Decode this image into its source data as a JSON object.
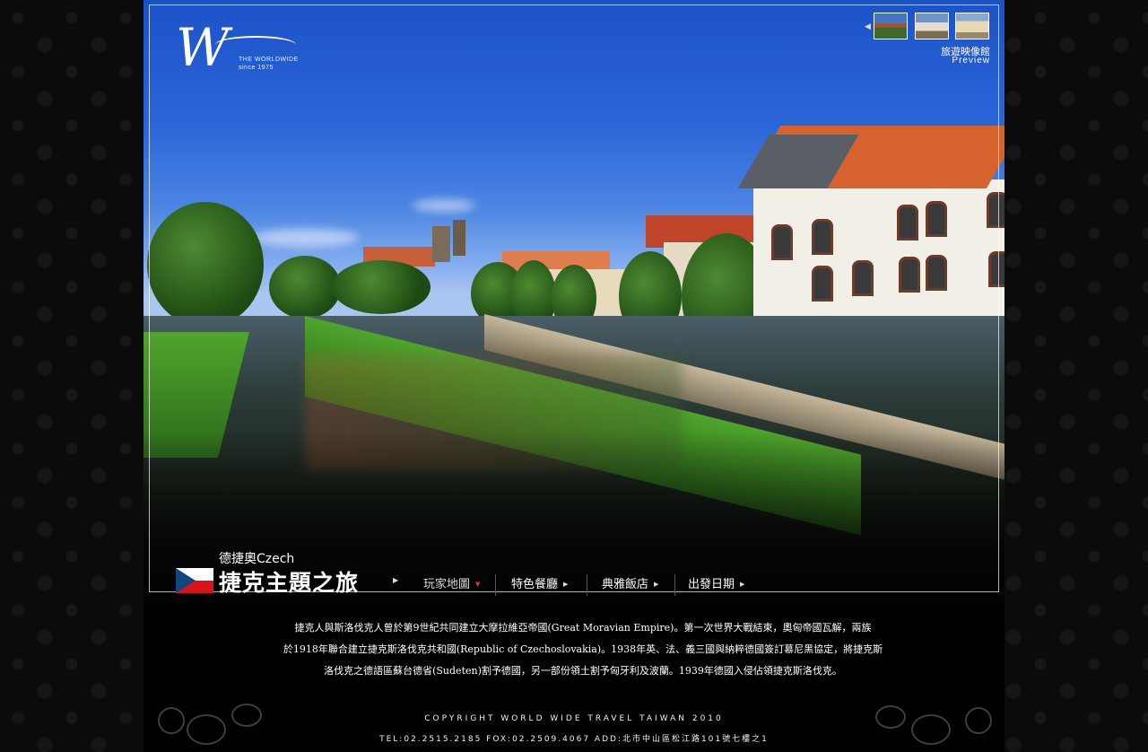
{
  "logo": {
    "mark": "W",
    "text_line1": "THE WORLDWIDE",
    "text_line2": "since 1975"
  },
  "gallery": {
    "title": "旅遊映像館",
    "subtitle": "Preview",
    "prev_icon": "arrow-left-icon"
  },
  "tour": {
    "subtitle": "德捷奧Czech",
    "title": "捷克主題之旅",
    "flag": "czech-flag"
  },
  "nav": [
    {
      "label": "玩家地圖",
      "active": true
    },
    {
      "label": "特色餐廳",
      "active": false
    },
    {
      "label": "典雅飯店",
      "active": false
    },
    {
      "label": "出發日期",
      "active": false
    }
  ],
  "intro": [
    "捷克人與斯洛伐克人曾於第9世紀共同建立大摩拉維亞帝國(Great Moravian Empire)。第一次世界大戰結束，奧匈帝國瓦解，兩族",
    "於1918年聯合建立捷克斯洛伐克共和國(Republic of Czechoslovakia)。1938年英、法、義三國與納粹德國簽訂慕尼黑協定，將捷克斯",
    "洛伐克之德語區蘇台德省(Sudeten)割予德國，另一部份領土割予匈牙利及波蘭。1939年德國入侵佔領捷克斯洛伐克。"
  ],
  "footer": {
    "copyright": "COPYRIGHT  WORLD WIDE TRAVEL TAIWAN 2010",
    "contact": "TEL:02.2515.2185 FOX:02.2509.4067 ADD:北市中山區松江路101號七樓之1"
  },
  "colors": {
    "nav_active_arrow": "#e1362c",
    "flag_blue": "#11457e",
    "flag_red": "#d7141a"
  }
}
